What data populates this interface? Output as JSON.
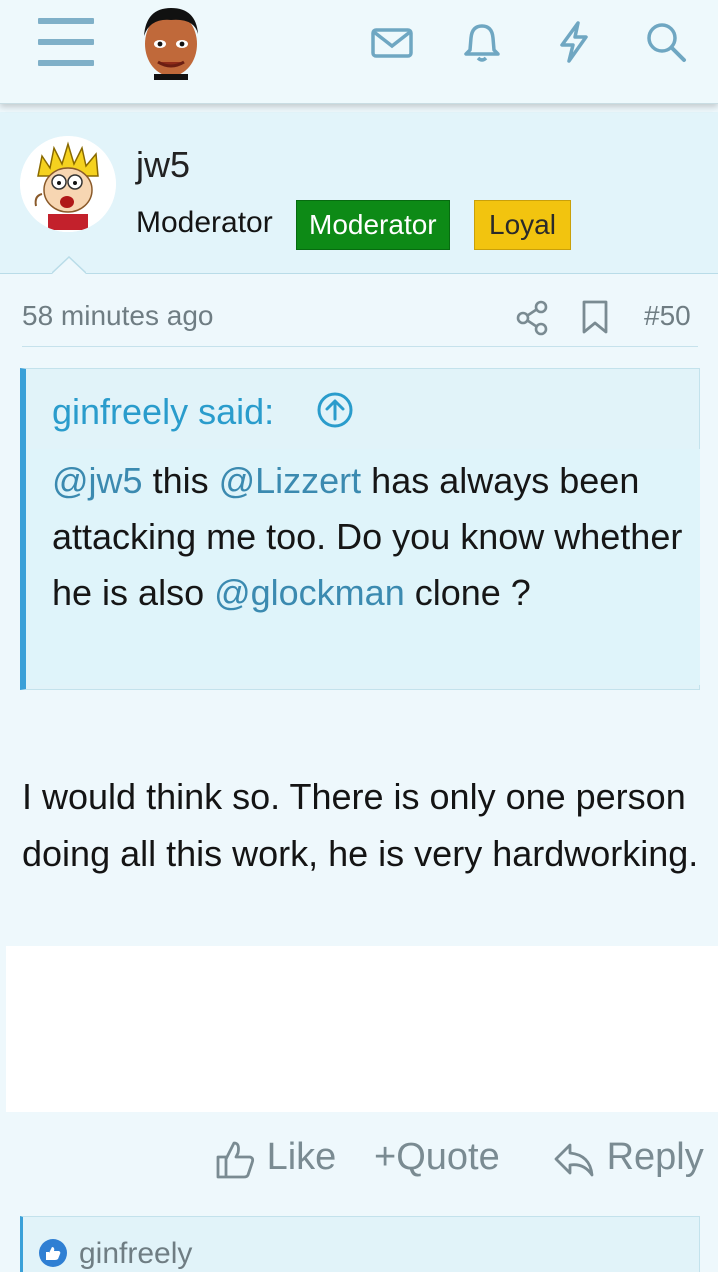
{
  "topbar": {
    "icons": [
      "menu-icon",
      "mail-icon",
      "bell-icon",
      "bolt-icon",
      "search-icon"
    ]
  },
  "post": {
    "username": "jw5",
    "user_title": "Moderator",
    "badges": [
      "Moderator",
      "Loyal"
    ],
    "badge_colors": {
      "moderator": "#0d8a16",
      "loyal": "#f2c40f"
    },
    "time": "58 minutes ago",
    "post_number": "#50",
    "quote": {
      "author_said": "ginfreely said:",
      "segments": [
        {
          "text": "@jw5",
          "mention": true
        },
        {
          "text": " this ",
          "mention": false
        },
        {
          "text": "@Lizzert",
          "mention": true
        },
        {
          "text": " has always been attacking me too. Do you know whether he is also ",
          "mention": false
        },
        {
          "text": "@glockman",
          "mention": true
        },
        {
          "text": " clone ?",
          "mention": false
        }
      ]
    },
    "body": "I would think so. There is only one person doing all this work, he is very hardworking."
  },
  "actions": {
    "like": "Like",
    "quote": "+Quote",
    "reply": "Reply"
  },
  "reactions": {
    "users": "ginfreely"
  },
  "colors": {
    "accent": "#3aa0d8",
    "link": "#2a9ccc",
    "muted": "#6f7d83"
  }
}
